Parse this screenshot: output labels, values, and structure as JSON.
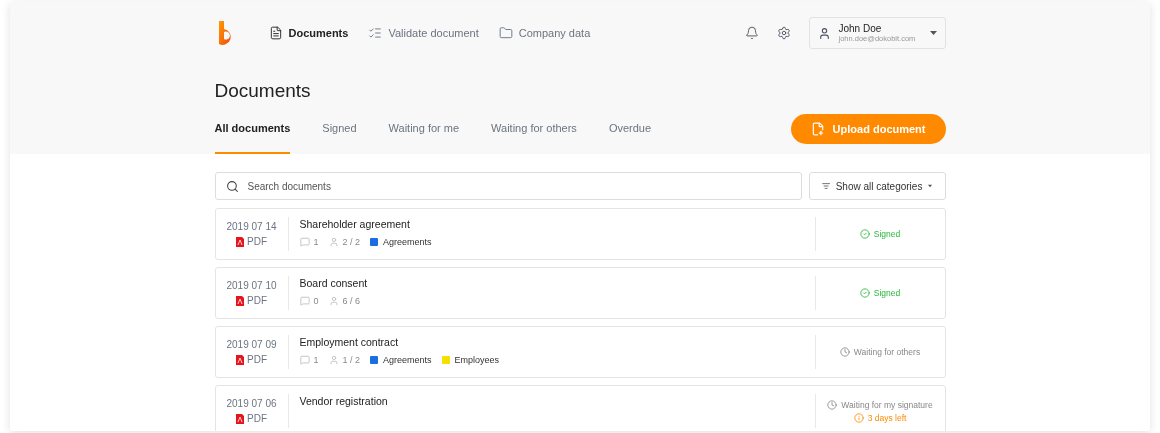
{
  "nav": {
    "items": [
      {
        "label": "Documents",
        "selected": true
      },
      {
        "label": "Validate document",
        "selected": false
      },
      {
        "label": "Company data",
        "selected": false
      }
    ]
  },
  "user": {
    "name": "John Doe",
    "email": "john.doe@dokobit.com"
  },
  "page_title": "Documents",
  "tabs": [
    {
      "label": "All documents",
      "selected": true
    },
    {
      "label": "Signed",
      "selected": false
    },
    {
      "label": "Waiting for me",
      "selected": false
    },
    {
      "label": "Waiting for others",
      "selected": false
    },
    {
      "label": "Overdue",
      "selected": false
    }
  ],
  "upload_button": "Upload document",
  "search": {
    "placeholder": "Search documents"
  },
  "category_filter": "Show all categories",
  "documents": [
    {
      "date": "2019 07 14",
      "format": "PDF",
      "title": "Shareholder agreement",
      "comments": "1",
      "signers": "2 / 2",
      "tags": [
        {
          "label": "Agreements",
          "color": "#1a6fe0"
        }
      ],
      "status": {
        "kind": "signed",
        "label": "Signed"
      }
    },
    {
      "date": "2019 07 10",
      "format": "PDF",
      "title": "Board consent",
      "comments": "0",
      "signers": "6 / 6",
      "status": {
        "kind": "signed",
        "label": "Signed"
      }
    },
    {
      "date": "2019 07 09",
      "format": "PDF",
      "title": "Employment contract",
      "comments": "1",
      "signers": "1 / 2",
      "tags": [
        {
          "label": "Agreements",
          "color": "#1a6fe0"
        },
        {
          "label": "Employees",
          "color": "#f5e000"
        }
      ],
      "status": {
        "kind": "waiting",
        "label": "Waiting for others"
      }
    },
    {
      "date": "2019 07 06",
      "format": "PDF",
      "title": "Vendor registration",
      "status": {
        "kind": "waiting",
        "label": "Waiting for my signature",
        "deadline": "3 days left"
      }
    }
  ]
}
